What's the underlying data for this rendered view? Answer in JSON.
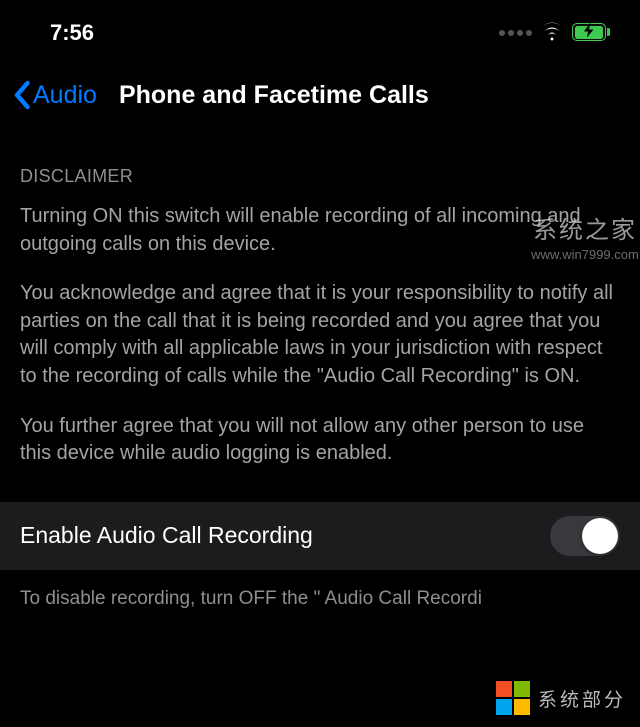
{
  "status_bar": {
    "time": "7:56"
  },
  "nav": {
    "back_label": "Audio",
    "title": "Phone and Facetime Calls"
  },
  "disclaimer": {
    "header": "DISCLAIMER",
    "paragraph1": "Turning ON this switch will enable recording of all incoming and outgoing calls on this device.",
    "paragraph2": "You acknowledge and agree that it is your responsibility to notify all parties on the call that it is being recorded and you agree that you will comply with all applicable laws in your jurisdiction with respect to the recording of calls while the \"Audio Call Recording\" is ON.",
    "paragraph3": "You further agree that you will not allow any other person to use this device while audio logging is enabled."
  },
  "toggle": {
    "label": "Enable Audio Call Recording",
    "enabled": false
  },
  "footer": {
    "text": "To disable recording, turn OFF the \" Audio Call Recordi"
  },
  "watermarks": {
    "top_text": "系统之家",
    "top_url": "www.win7999.com",
    "bottom_text": "系统部分"
  }
}
